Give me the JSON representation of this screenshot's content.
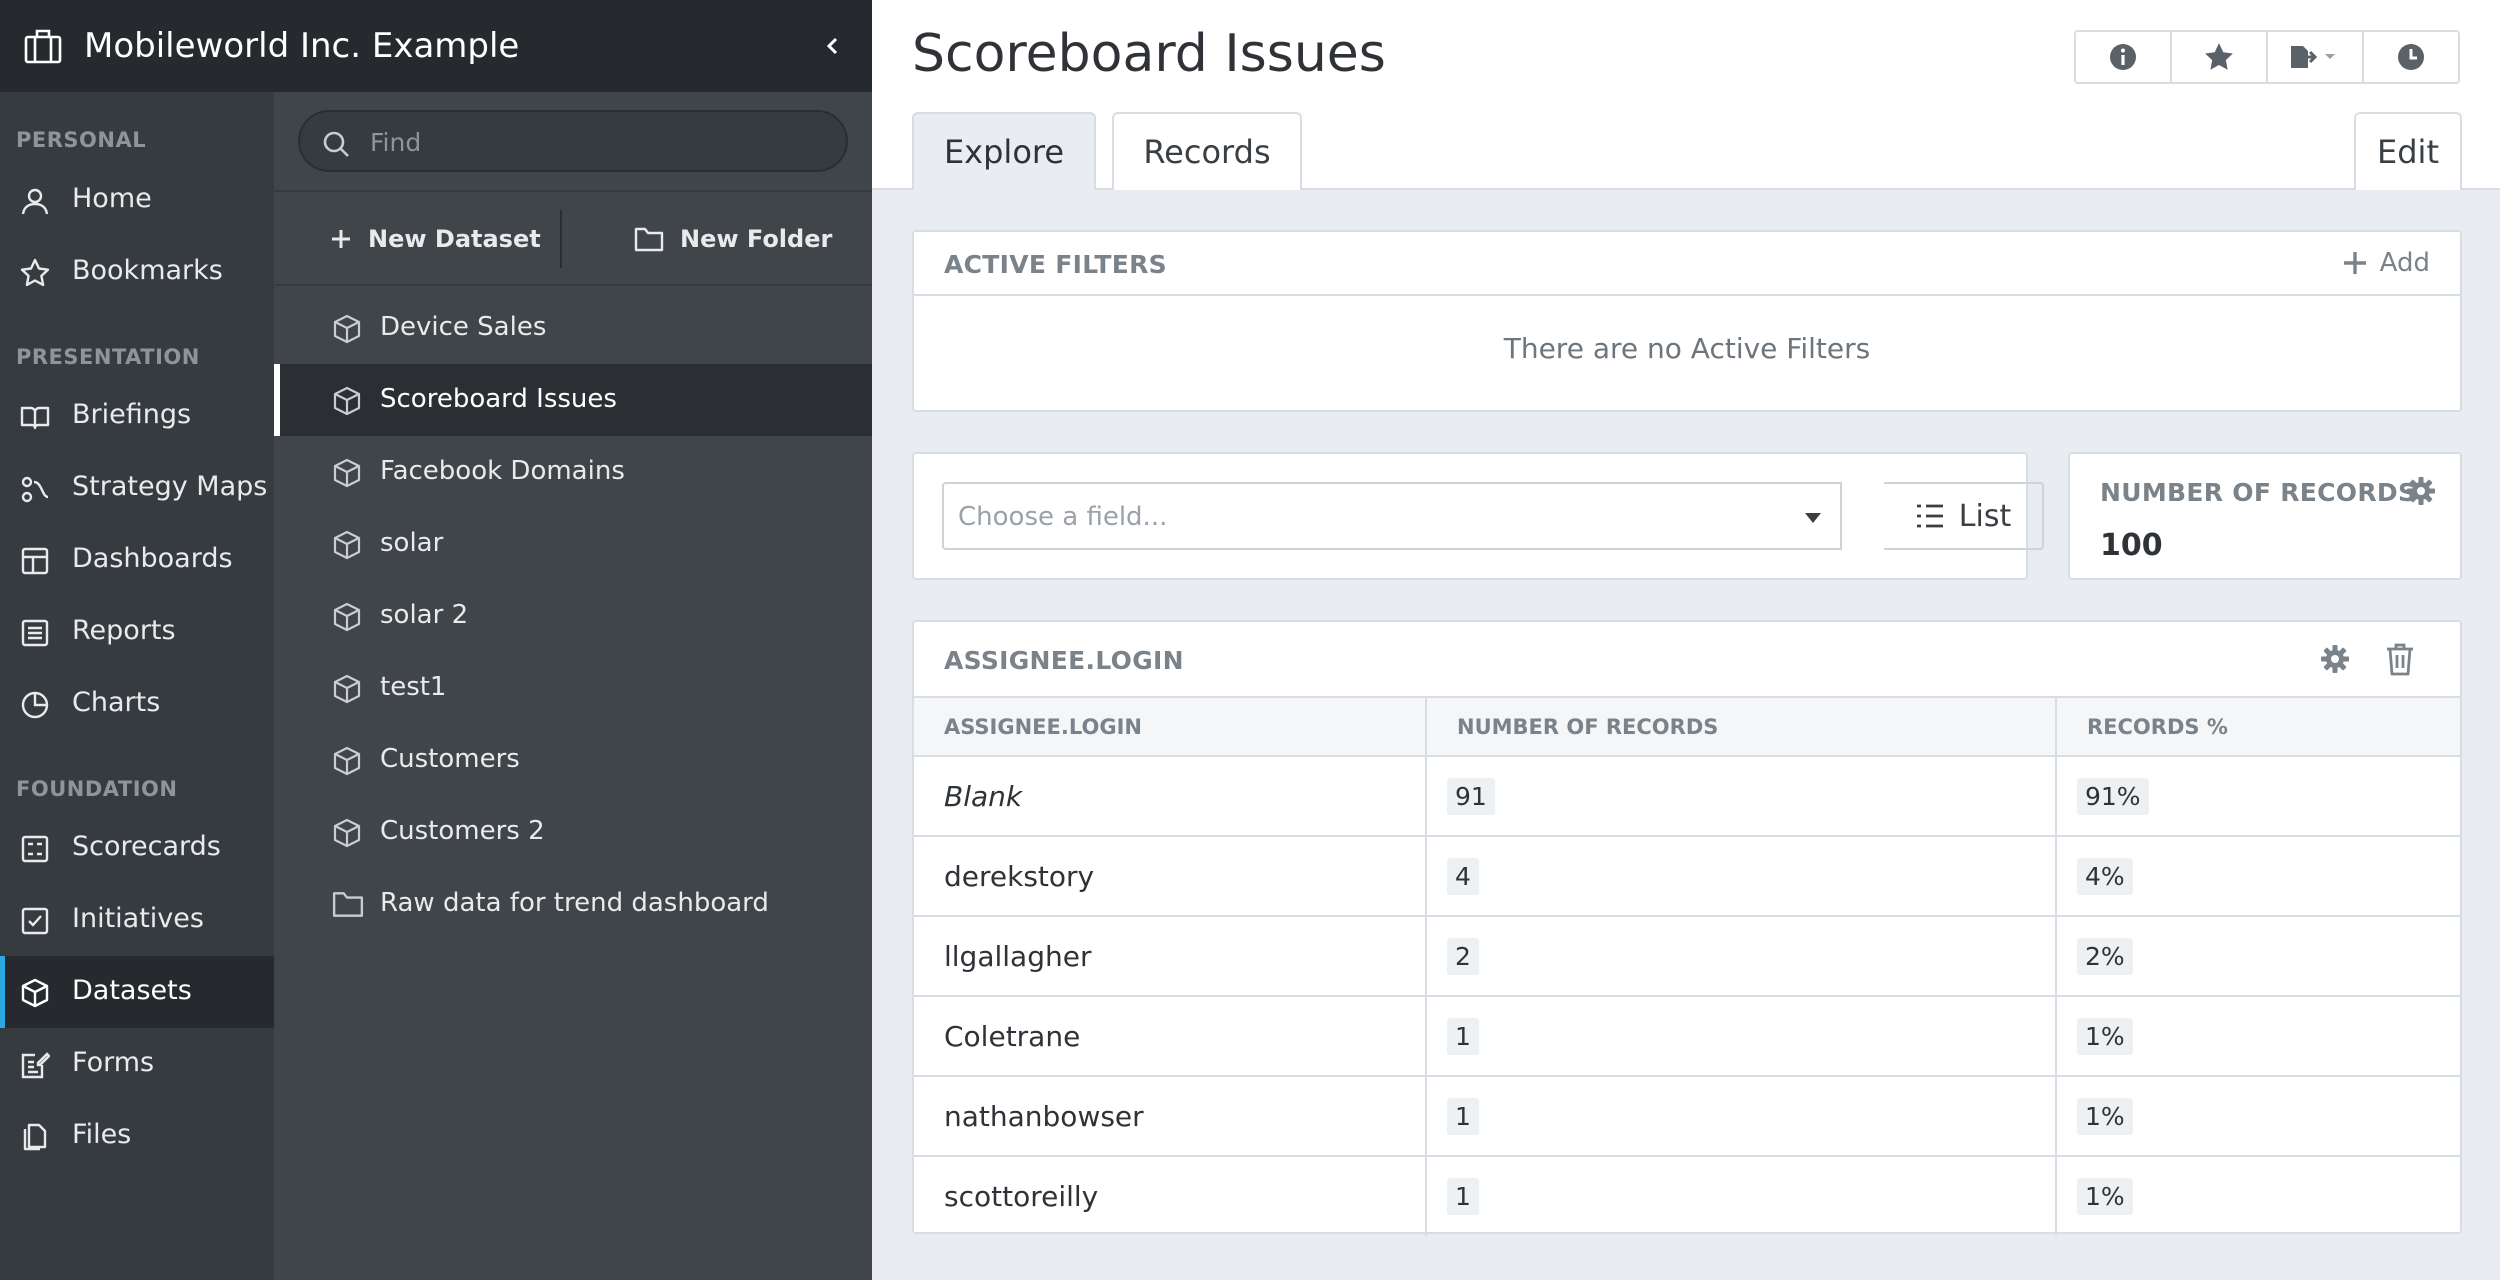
{
  "org": {
    "name": "Mobileworld Inc. Example"
  },
  "nav": {
    "sections": [
      {
        "label": "PERSONAL"
      },
      {
        "label": "PRESENTATION"
      },
      {
        "label": "FOUNDATION"
      }
    ],
    "items": [
      {
        "label": "Home",
        "icon": "user-icon"
      },
      {
        "label": "Bookmarks",
        "icon": "star-icon"
      },
      {
        "label": "Briefings",
        "icon": "book-icon"
      },
      {
        "label": "Strategy Maps",
        "icon": "strategy-map-icon"
      },
      {
        "label": "Dashboards",
        "icon": "dashboard-icon"
      },
      {
        "label": "Reports",
        "icon": "report-icon"
      },
      {
        "label": "Charts",
        "icon": "pie-chart-icon"
      },
      {
        "label": "Scorecards",
        "icon": "scorecard-icon"
      },
      {
        "label": "Initiatives",
        "icon": "checkbox-icon"
      },
      {
        "label": "Datasets",
        "icon": "cube-icon",
        "active": true
      },
      {
        "label": "Forms",
        "icon": "form-icon"
      },
      {
        "label": "Files",
        "icon": "files-icon"
      }
    ]
  },
  "panel": {
    "search_placeholder": "Find",
    "new_dataset_label": "New Dataset",
    "new_folder_label": "New Folder",
    "datasets": [
      {
        "label": "Device Sales",
        "icon": "cube-icon"
      },
      {
        "label": "Scoreboard Issues",
        "icon": "cube-icon",
        "active": true
      },
      {
        "label": "Facebook Domains",
        "icon": "cube-icon"
      },
      {
        "label": "solar",
        "icon": "cube-icon"
      },
      {
        "label": "solar 2",
        "icon": "cube-icon"
      },
      {
        "label": "test1",
        "icon": "cube-icon"
      },
      {
        "label": "Customers",
        "icon": "cube-icon"
      },
      {
        "label": "Customers 2",
        "icon": "cube-icon"
      },
      {
        "label": "Raw data for trend dashboard",
        "icon": "folder-icon"
      }
    ]
  },
  "main": {
    "title": "Scoreboard Issues",
    "tabs": [
      {
        "label": "Explore",
        "active": true
      },
      {
        "label": "Records"
      }
    ],
    "edit_label": "Edit",
    "filters": {
      "title": "ACTIVE FILTERS",
      "add_label": "Add",
      "empty_text": "There are no Active Filters"
    },
    "field_chooser": {
      "placeholder": "Choose a field...",
      "list_label": "List"
    },
    "count_card": {
      "title": "NUMBER OF RECORDS",
      "value": "100"
    },
    "table": {
      "title": "ASSIGNEE.LOGIN",
      "columns": [
        "ASSIGNEE.LOGIN",
        "NUMBER OF RECORDS",
        "RECORDS %"
      ],
      "rows": [
        {
          "login": "Blank",
          "count": "91",
          "pct": "91%"
        },
        {
          "login": "derekstory",
          "count": "4",
          "pct": "4%"
        },
        {
          "login": "llgallagher",
          "count": "2",
          "pct": "2%"
        },
        {
          "login": "Coletrane",
          "count": "1",
          "pct": "1%"
        },
        {
          "login": "nathanbowser",
          "count": "1",
          "pct": "1%"
        },
        {
          "login": "scottoreilly",
          "count": "1",
          "pct": "1%"
        }
      ]
    }
  },
  "colors": {
    "nav_bg": "#363b40",
    "nav_dark": "#262a2e",
    "accent": "#2aa8e0",
    "panel_bg": "#40454a",
    "main_bg": "#e9edf2"
  }
}
